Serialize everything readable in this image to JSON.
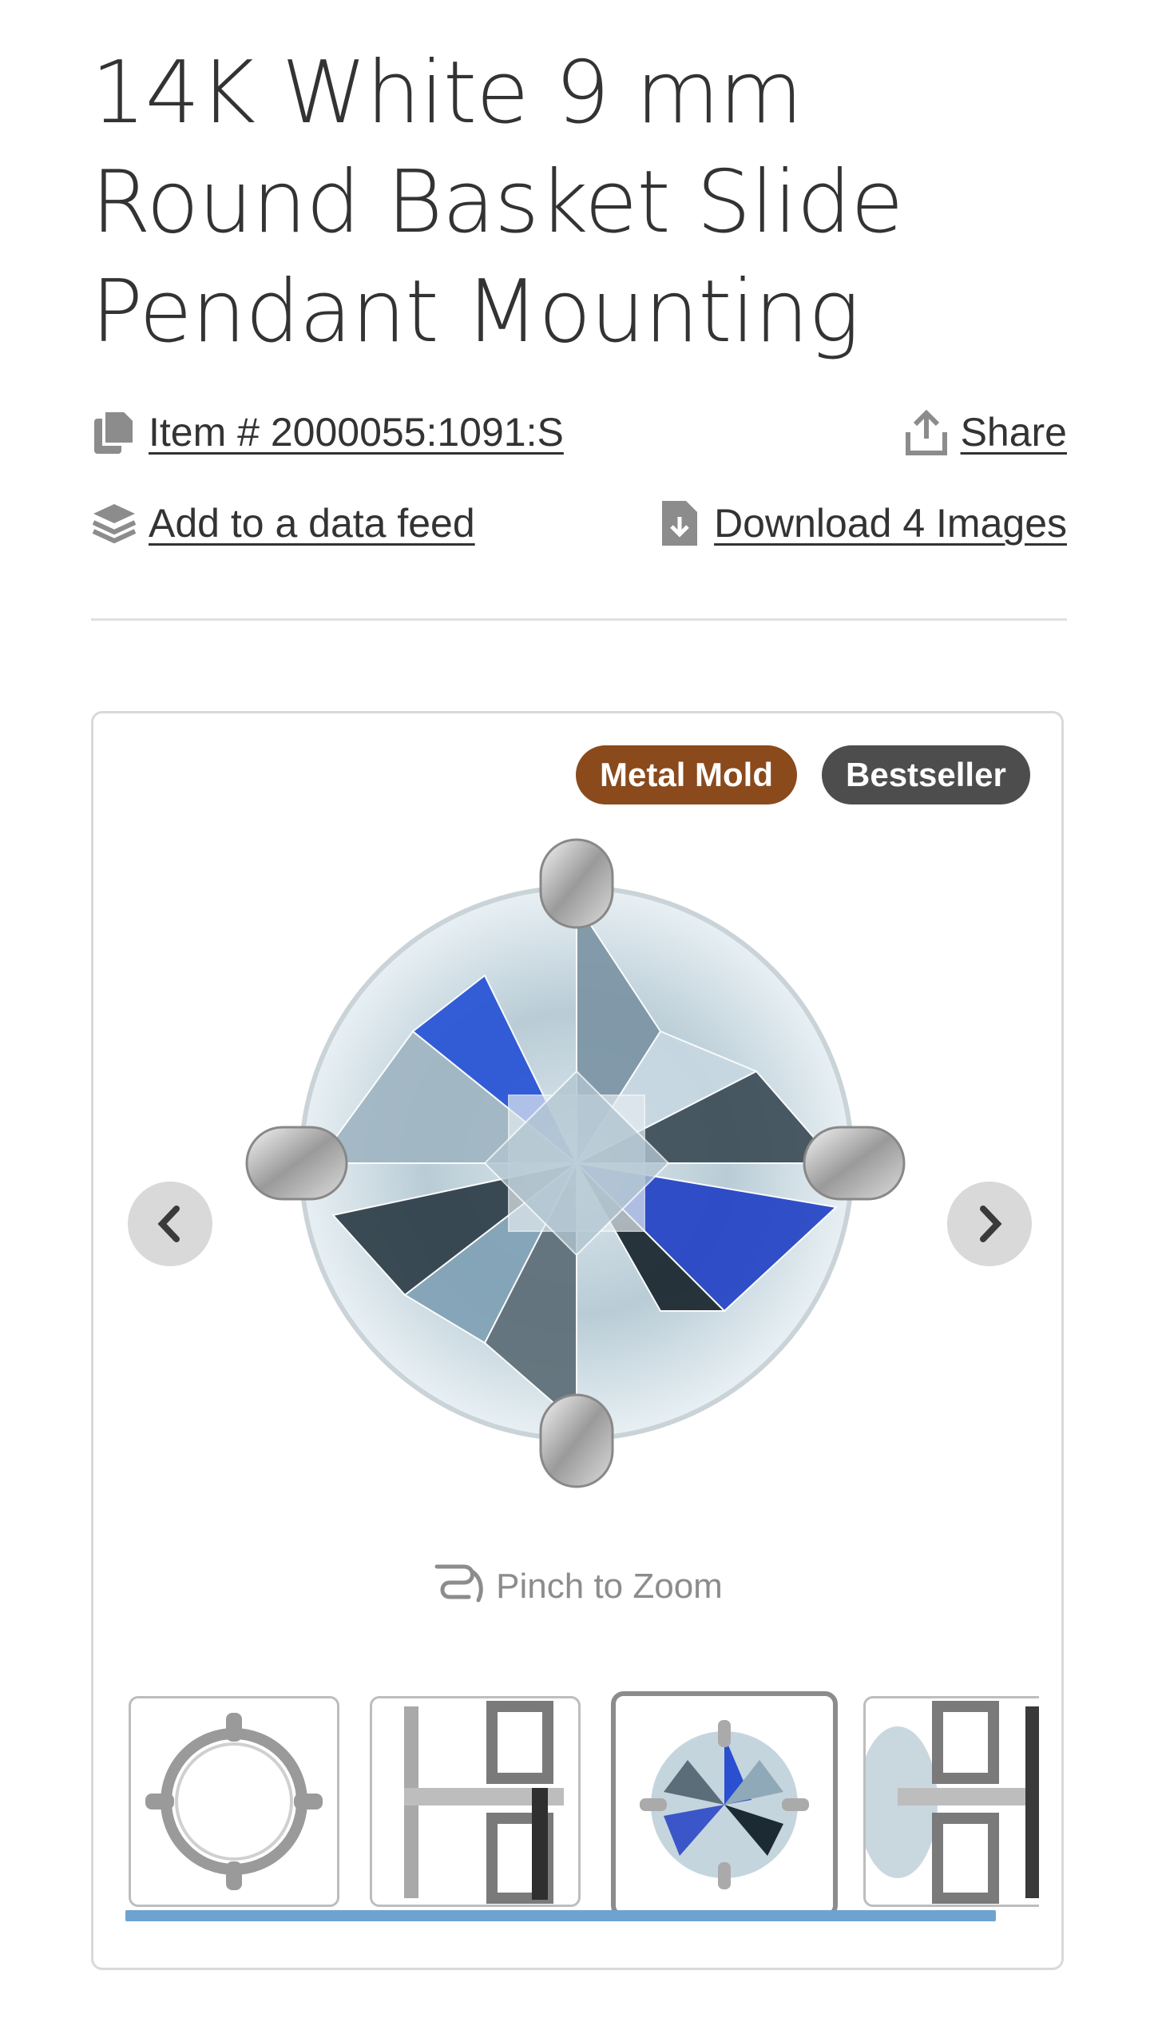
{
  "product": {
    "title": "14K White 9 mm Round Basket Slide Pendant Mounting",
    "item_label": "Item # 2000055:1091:S",
    "share_label": "Share",
    "data_feed_label": "Add to a data feed",
    "download_label": "Download 4 Images"
  },
  "gallery": {
    "badges": [
      "Metal Mold",
      "Bestseller"
    ],
    "zoom_hint": "Pinch to Zoom",
    "thumbnails_count": 4,
    "active_thumbnail_index": 2
  },
  "colors": {
    "badge_mold": "#8a4a1c",
    "badge_bestseller": "#4d4d4d",
    "scrollbar": "#6fa3cf"
  },
  "icons": [
    "copy-icon",
    "share-icon",
    "layers-icon",
    "file-download-icon",
    "chevron-left-icon",
    "chevron-right-icon",
    "pinch-icon"
  ]
}
